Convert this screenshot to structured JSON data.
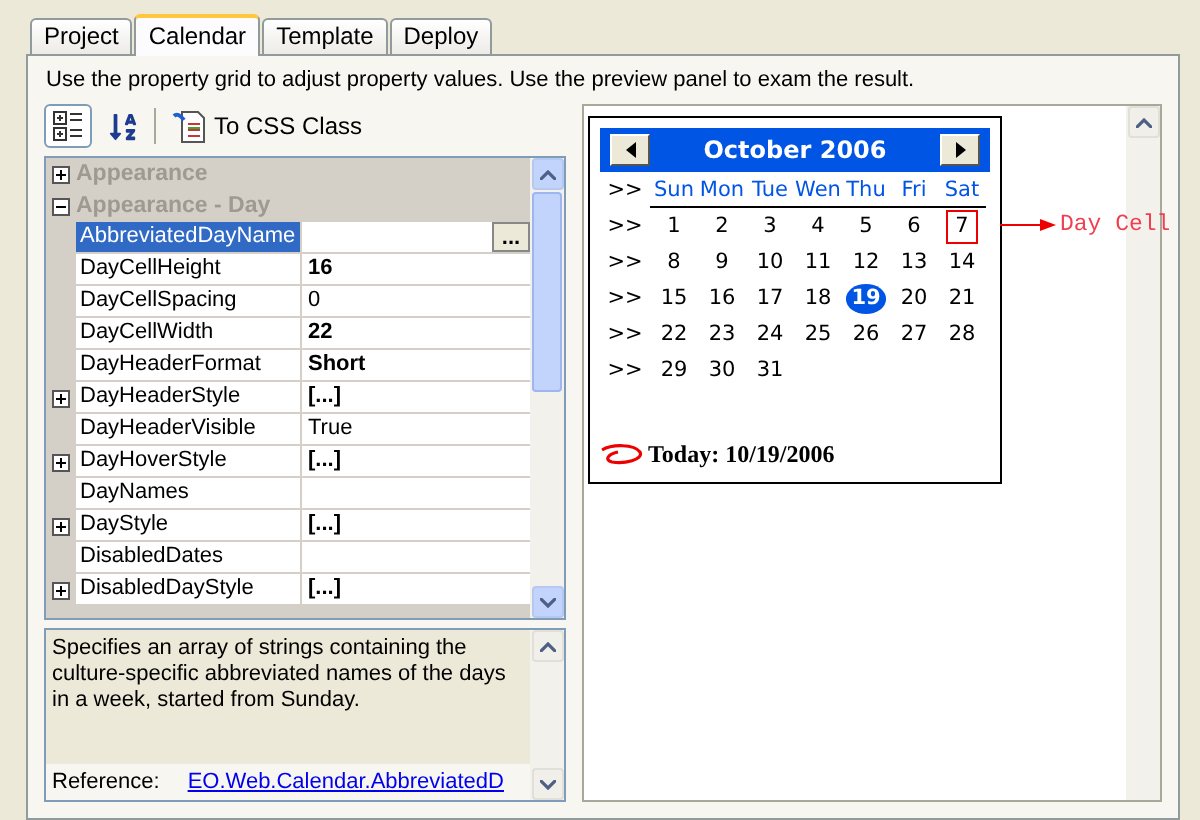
{
  "tabs": [
    {
      "label": "Project",
      "selected": false
    },
    {
      "label": "Calendar",
      "selected": true
    },
    {
      "label": "Template",
      "selected": false
    },
    {
      "label": "Deploy",
      "selected": false
    }
  ],
  "instruction": "Use the property grid to adjust property values. Use the preview panel to exam the result.",
  "toolbar": {
    "categorized_selected": true,
    "alphabetical_selected": false,
    "css_button": "To CSS Class"
  },
  "grid": {
    "categories": [
      {
        "name": "Appearance",
        "expanded": false
      },
      {
        "name": "Appearance - Day",
        "expanded": true,
        "properties": [
          {
            "name": "AbbreviatedDayName",
            "expandable": false,
            "selected": true,
            "ellipsis": "..."
          },
          {
            "name": "DayCellHeight",
            "value": "16",
            "modified": true,
            "expandable": false,
            "selected": false
          },
          {
            "name": "DayCellSpacing",
            "value": "0",
            "modified": false,
            "expandable": false,
            "selected": false
          },
          {
            "name": "DayCellWidth",
            "value": "22",
            "modified": true,
            "expandable": false,
            "selected": false
          },
          {
            "name": "DayHeaderFormat",
            "value": "Short",
            "modified": true,
            "expandable": false,
            "selected": false
          },
          {
            "name": "DayHeaderStyle",
            "value": "[...]",
            "modified": true,
            "expandable": true,
            "selected": false
          },
          {
            "name": "DayHeaderVisible",
            "value": "True",
            "modified": false,
            "expandable": false,
            "selected": false
          },
          {
            "name": "DayHoverStyle",
            "value": "[...]",
            "modified": true,
            "expandable": true,
            "selected": false
          },
          {
            "name": "DayNames",
            "expandable": false,
            "selected": false
          },
          {
            "name": "DayStyle",
            "value": "[...]",
            "modified": true,
            "expandable": true,
            "selected": false
          },
          {
            "name": "DisabledDates",
            "expandable": false,
            "selected": false
          },
          {
            "name": "DisabledDayStyle",
            "value": "[...]",
            "modified": true,
            "expandable": true,
            "selected": false
          }
        ]
      }
    ]
  },
  "description": {
    "text": "Specifies an array of strings containing the culture-specific abbreviated names of the days in a week, started from Sunday.",
    "reference_label": "Reference:",
    "reference_link": "EO.Web.Calendar.AbbreviatedD"
  },
  "calendar": {
    "title": "October 2006",
    "day_headers": [
      "Sun",
      "Mon",
      "Tue",
      "Wen",
      "Thu",
      "Fri",
      "Sat"
    ],
    "weeks": [
      {
        "selector": ">>",
        "days": [
          {
            "label": "1",
            "selected": false,
            "annotated": false
          },
          {
            "label": "2",
            "selected": false,
            "annotated": false
          },
          {
            "label": "3",
            "selected": false,
            "annotated": false
          },
          {
            "label": "4",
            "selected": false,
            "annotated": false
          },
          {
            "label": "5",
            "selected": false,
            "annotated": false
          },
          {
            "label": "6",
            "selected": false,
            "annotated": false
          },
          {
            "label": "7",
            "selected": false,
            "annotated": true
          }
        ]
      },
      {
        "selector": ">>",
        "days": [
          {
            "label": "8",
            "selected": false,
            "annotated": false
          },
          {
            "label": "9",
            "selected": false,
            "annotated": false
          },
          {
            "label": "10",
            "selected": false,
            "annotated": false
          },
          {
            "label": "11",
            "selected": false,
            "annotated": false
          },
          {
            "label": "12",
            "selected": false,
            "annotated": false
          },
          {
            "label": "13",
            "selected": false,
            "annotated": false
          },
          {
            "label": "14",
            "selected": false,
            "annotated": false
          }
        ]
      },
      {
        "selector": ">>",
        "days": [
          {
            "label": "15",
            "selected": false,
            "annotated": false
          },
          {
            "label": "16",
            "selected": false,
            "annotated": false
          },
          {
            "label": "17",
            "selected": false,
            "annotated": false
          },
          {
            "label": "18",
            "selected": false,
            "annotated": false
          },
          {
            "label": "19",
            "selected": true,
            "annotated": false
          },
          {
            "label": "20",
            "selected": false,
            "annotated": false
          },
          {
            "label": "21",
            "selected": false,
            "annotated": false
          }
        ]
      },
      {
        "selector": ">>",
        "days": [
          {
            "label": "22",
            "selected": false,
            "annotated": false
          },
          {
            "label": "23",
            "selected": false,
            "annotated": false
          },
          {
            "label": "24",
            "selected": false,
            "annotated": false
          },
          {
            "label": "25",
            "selected": false,
            "annotated": false
          },
          {
            "label": "26",
            "selected": false,
            "annotated": false
          },
          {
            "label": "27",
            "selected": false,
            "annotated": false
          },
          {
            "label": "28",
            "selected": false,
            "annotated": false
          }
        ]
      },
      {
        "selector": ">>",
        "days": [
          {
            "label": "29",
            "selected": false,
            "annotated": false
          },
          {
            "label": "30",
            "selected": false,
            "annotated": false
          },
          {
            "label": "31",
            "selected": false,
            "annotated": false
          }
        ]
      }
    ],
    "today": "Today: 10/19/2006",
    "annotation": "Day Cell"
  }
}
